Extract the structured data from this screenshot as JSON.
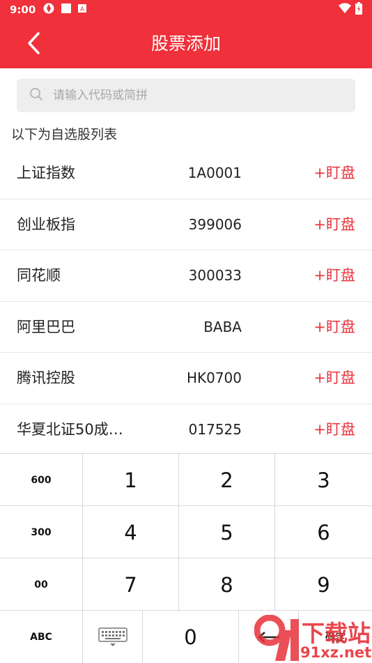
{
  "status_bar": {
    "time": "9:00"
  },
  "app_bar": {
    "title": "股票添加"
  },
  "search": {
    "placeholder": "请输入代码或简拼"
  },
  "section_label": "以下为自选股列表",
  "stocks": [
    {
      "name": "上证指数",
      "code": "1A0001",
      "action": "+盯盘"
    },
    {
      "name": "创业板指",
      "code": "399006",
      "action": "+盯盘"
    },
    {
      "name": "同花顺",
      "code": "300033",
      "action": "+盯盘"
    },
    {
      "name": "阿里巴巴",
      "code": "BABA",
      "action": "+盯盘"
    },
    {
      "name": "腾讯控股",
      "code": "HK0700",
      "action": "+盯盘"
    },
    {
      "name": "华夏北证50成…",
      "code": "017525",
      "action": "+盯盘"
    }
  ],
  "keyboard": {
    "row1": [
      "600",
      "1",
      "2",
      "3"
    ],
    "row2": [
      "300",
      "4",
      "5",
      "6"
    ],
    "row3": [
      "00",
      "7",
      "8",
      "9"
    ],
    "row4": {
      "abc": "ABC",
      "zero": "0",
      "confirm": "确定"
    }
  },
  "watermark": {
    "brand": "下载站",
    "site": "91xz.net"
  },
  "colors": {
    "accent": "#f0303a",
    "action": "#e8323b"
  }
}
